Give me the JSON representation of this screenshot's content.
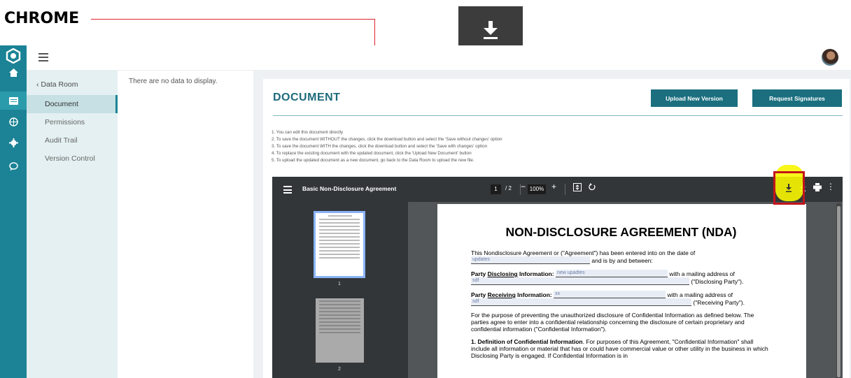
{
  "annotation": {
    "browser_label": "CHROME",
    "colors": {
      "arrow": "#e0242c",
      "highlight": "#f7f600",
      "box": "#c3141b"
    }
  },
  "app": {
    "icons": [
      "logo-icon",
      "home-icon",
      "document-list-icon",
      "globe-icon",
      "gear-icon",
      "chat-icon"
    ]
  },
  "subnav": {
    "back_label": "‹ Data Room",
    "items": [
      {
        "label": "Document",
        "active": true
      },
      {
        "label": "Permissions"
      },
      {
        "label": "Audit Trail"
      },
      {
        "label": "Version Control"
      }
    ]
  },
  "list": {
    "empty_text": "There are no data to display."
  },
  "document": {
    "title": "DOCUMENT",
    "upload_button": "Upload New Version",
    "signatures_button": "Request Signatures",
    "instructions": [
      "1. You can edit this document directly",
      "2. To save the document WITHOUT the changes, click the download button and select the 'Save without changes' option",
      "3. To save the document WITH the changes, click the download button and select the 'Save with changes' option",
      "4. To replace the existing document with the updated document, click the 'Upload New Document' button",
      "5. To upload the updated document as a new document, go back to the Data Room to upload the new file."
    ]
  },
  "pdf": {
    "name": "Basic Non-Disclosure Agreement",
    "page_current": "1",
    "page_total": "/ 2",
    "zoom": "100%",
    "thumb_labels": [
      "1",
      "2"
    ],
    "heading": "NON-DISCLOSURE AGREEMENT (NDA)",
    "p1_prefix": "This Nondisclosure Agreement or (\"Agreement\") has been entered into on the date of",
    "p1_field": "updates",
    "p1_suffix": "and is by and between:",
    "disc_label_a": "Party ",
    "disc_label_u": "Disclosing",
    "disc_label_b": " Information:",
    "disc_field": "new upadtes",
    "disc_mail": "with a mailing address of",
    "disc_field2": "sdf",
    "disc_party": "(\"Disclosing Party\").",
    "recv_label_a": "Party ",
    "recv_label_u": "Receiving",
    "recv_label_b": " Information:",
    "recv_field": "xx",
    "recv_mail": "with a mailing address of",
    "recv_field2": "sdf",
    "recv_party": "(\"Receiving Party\").",
    "purpose": "For the purpose of preventing the unauthorized disclosure of Confidential Information as defined below. The parties agree to enter into a confidential relationship concerning the disclosure of certain proprietary and confidential information (\"Confidential Information\").",
    "def_bold": "1. Definition of Confidential Information",
    "def_text": ". For purposes of this Agreement, \"Confidential Information\" shall include all information or material that has or could have commercial value or other utility in the business in which Disclosing Party is engaged. If Confidential Information is in"
  }
}
